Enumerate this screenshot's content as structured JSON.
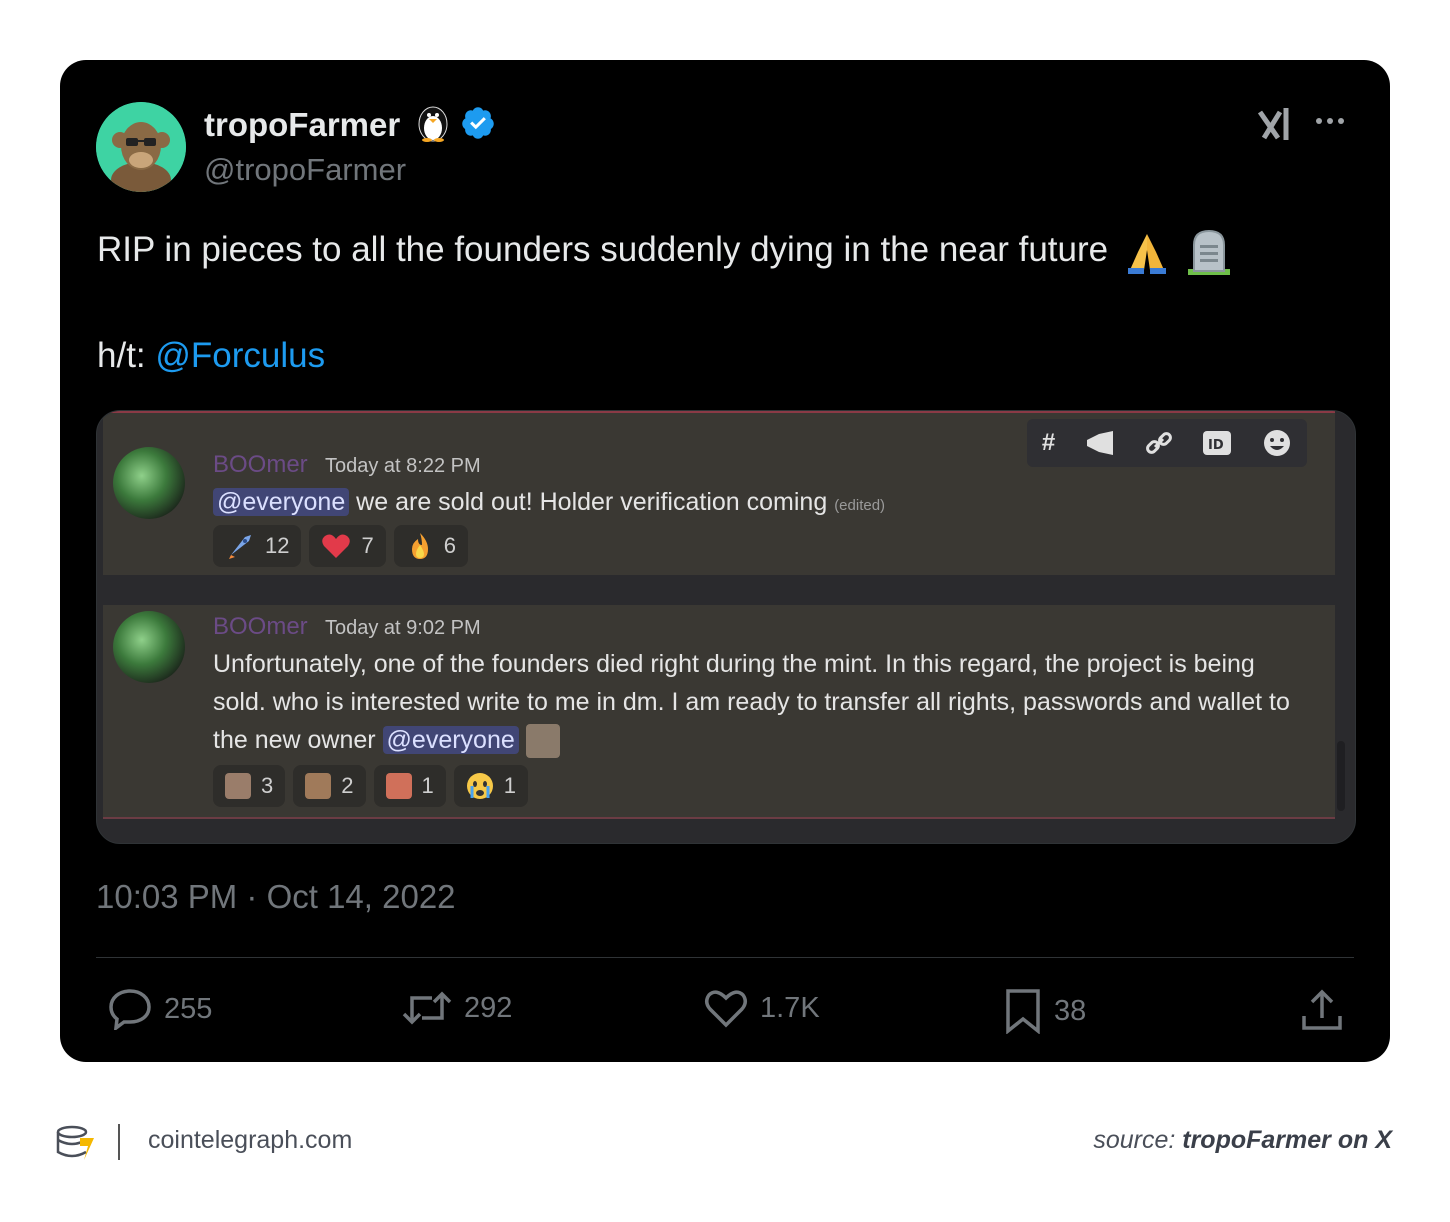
{
  "tweet": {
    "display_name": "tropoFarmer",
    "handle": "@tropoFarmer",
    "text": "RIP in pieces to all the founders suddenly dying in the near future",
    "ht_prefix": "h/t: ",
    "ht_mention": "@Forculus",
    "timestamp": "10:03 PM · Oct 14, 2022",
    "verified_color": "#1d9bf0",
    "icons": [
      "penguin-icon",
      "verified-badge-icon",
      "grok-icon",
      "more-icon",
      "pray-emoji",
      "headstone-emoji"
    ]
  },
  "embedded_discord": {
    "toolbar_icons": [
      "threads-icon",
      "megaphone-icon",
      "link-icon",
      "id-icon",
      "smiley-icon"
    ],
    "messages": [
      {
        "author": "BOOmer",
        "time": "Today at 8:22 PM",
        "mention": "@everyone",
        "text": " we are sold out! Holder verification coming ",
        "edited": "(edited)",
        "reactions": [
          {
            "icon": "rocket-icon",
            "count": "12"
          },
          {
            "icon": "heart-icon",
            "count": "7"
          },
          {
            "icon": "fire-icon",
            "count": "6"
          }
        ]
      },
      {
        "author": "BOOmer",
        "time": "Today at 9:02 PM",
        "text": "Unfortunately, one of the founders died right during the mint. In this regard, the project is being sold. who is interested write to me in dm. I am ready to transfer all rights, passwords and wallet to the new owner ",
        "mention": "@everyone",
        "reactions": [
          {
            "icon": "face-emote-icon",
            "count": "3"
          },
          {
            "icon": "face-emote-icon",
            "count": "2"
          },
          {
            "icon": "face-emote-icon",
            "count": "1"
          },
          {
            "icon": "crying-face-icon",
            "count": "1"
          }
        ]
      }
    ]
  },
  "actions": {
    "replies": "255",
    "reposts": "292",
    "likes": "1.7K",
    "bookmarks": "38"
  },
  "footer": {
    "site": "cointelegraph.com",
    "source_prefix": "source: ",
    "source_name": "tropoFarmer on X"
  }
}
